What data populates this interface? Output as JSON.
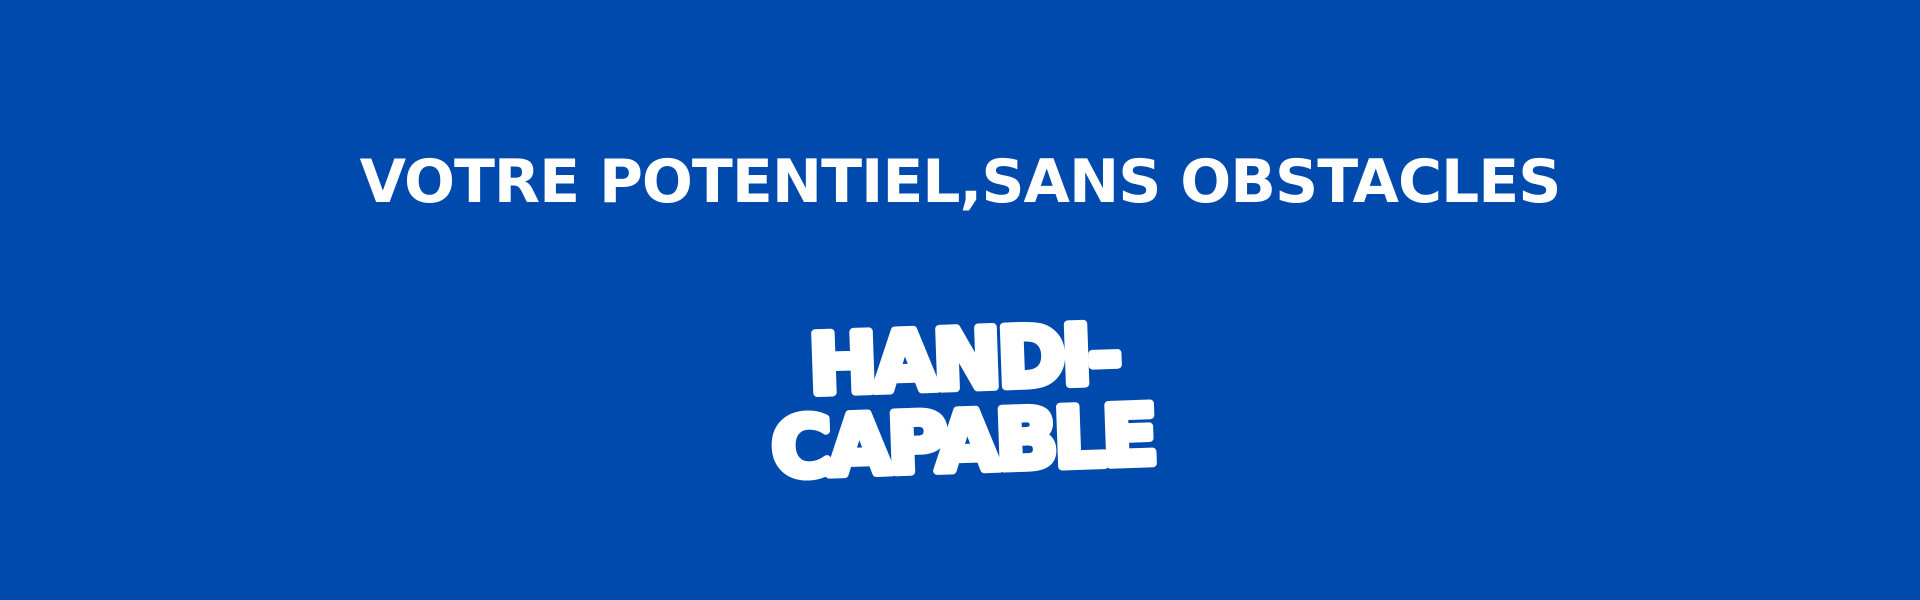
{
  "banner": {
    "background_color": "#004aad",
    "text_color": "#ffffff",
    "tagline": "VOTRE POTENTIEL,SANS OBSTACLES",
    "logo": {
      "line1": "HANDI-",
      "line2": "CAPABLE"
    }
  }
}
